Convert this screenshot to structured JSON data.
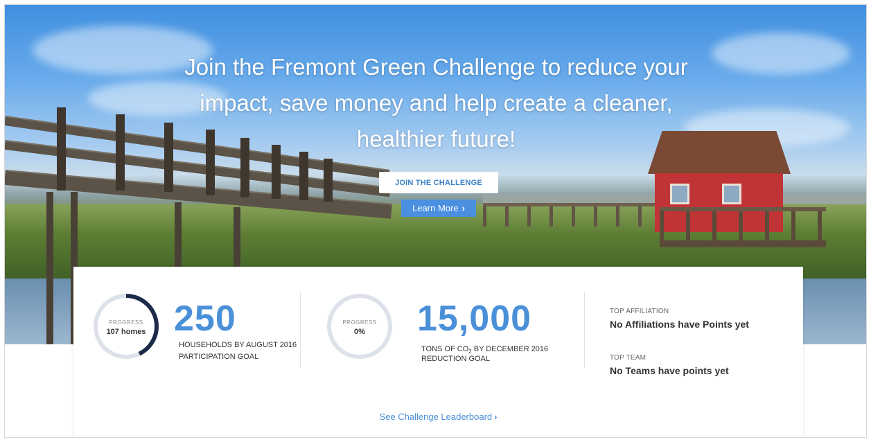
{
  "hero": {
    "headline": "Join the Fremont Green Challenge to reduce your impact, save money and help create a cleaner, healthier future!",
    "join_button": "JOIN THE CHALLENGE",
    "learn_more_button": "Learn More",
    "chevron": "›"
  },
  "stats": {
    "households": {
      "ring_label": "PROGRESS",
      "ring_value": "107 homes",
      "progress_fraction": 0.428,
      "goal_number": "250",
      "goal_line1": "HOUSEHOLDS BY AUGUST 2016",
      "goal_line2": "PARTICIPATION GOAL"
    },
    "co2": {
      "ring_label": "PROGRESS",
      "ring_value": "0%",
      "progress_fraction": 0,
      "goal_number": "15,000",
      "goal_line1_prefix": "TONS OF CO",
      "goal_line1_sub": "2",
      "goal_line1_suffix": " BY DECEMBER 2016",
      "goal_line2": "REDUCTION GOAL"
    },
    "top_affiliation": {
      "label": "TOP AFFILIATION",
      "value": "No Affiliations have Points yet"
    },
    "top_team": {
      "label": "TOP TEAM",
      "value": "No Teams have points yet"
    },
    "leaderboard_link": "See Challenge Leaderboard",
    "chevron": "›"
  },
  "colors": {
    "accent": "#4a90d9",
    "ring_track": "#dde2ea",
    "ring_fill": "#1d2a4a"
  }
}
